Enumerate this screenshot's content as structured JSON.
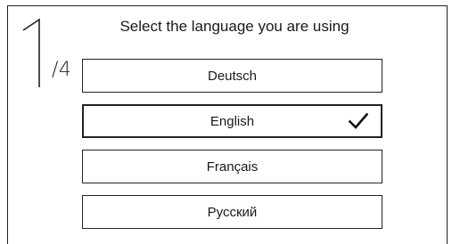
{
  "wizard": {
    "step_current": "1",
    "step_total": "/4",
    "prompt": "Select the language you are using"
  },
  "languages": [
    {
      "label": "Deutsch",
      "selected": false
    },
    {
      "label": "English",
      "selected": true
    },
    {
      "label": "Français",
      "selected": false
    },
    {
      "label": "Русский",
      "selected": false
    }
  ],
  "icons": {
    "selected_marker": "checkmark-icon"
  }
}
